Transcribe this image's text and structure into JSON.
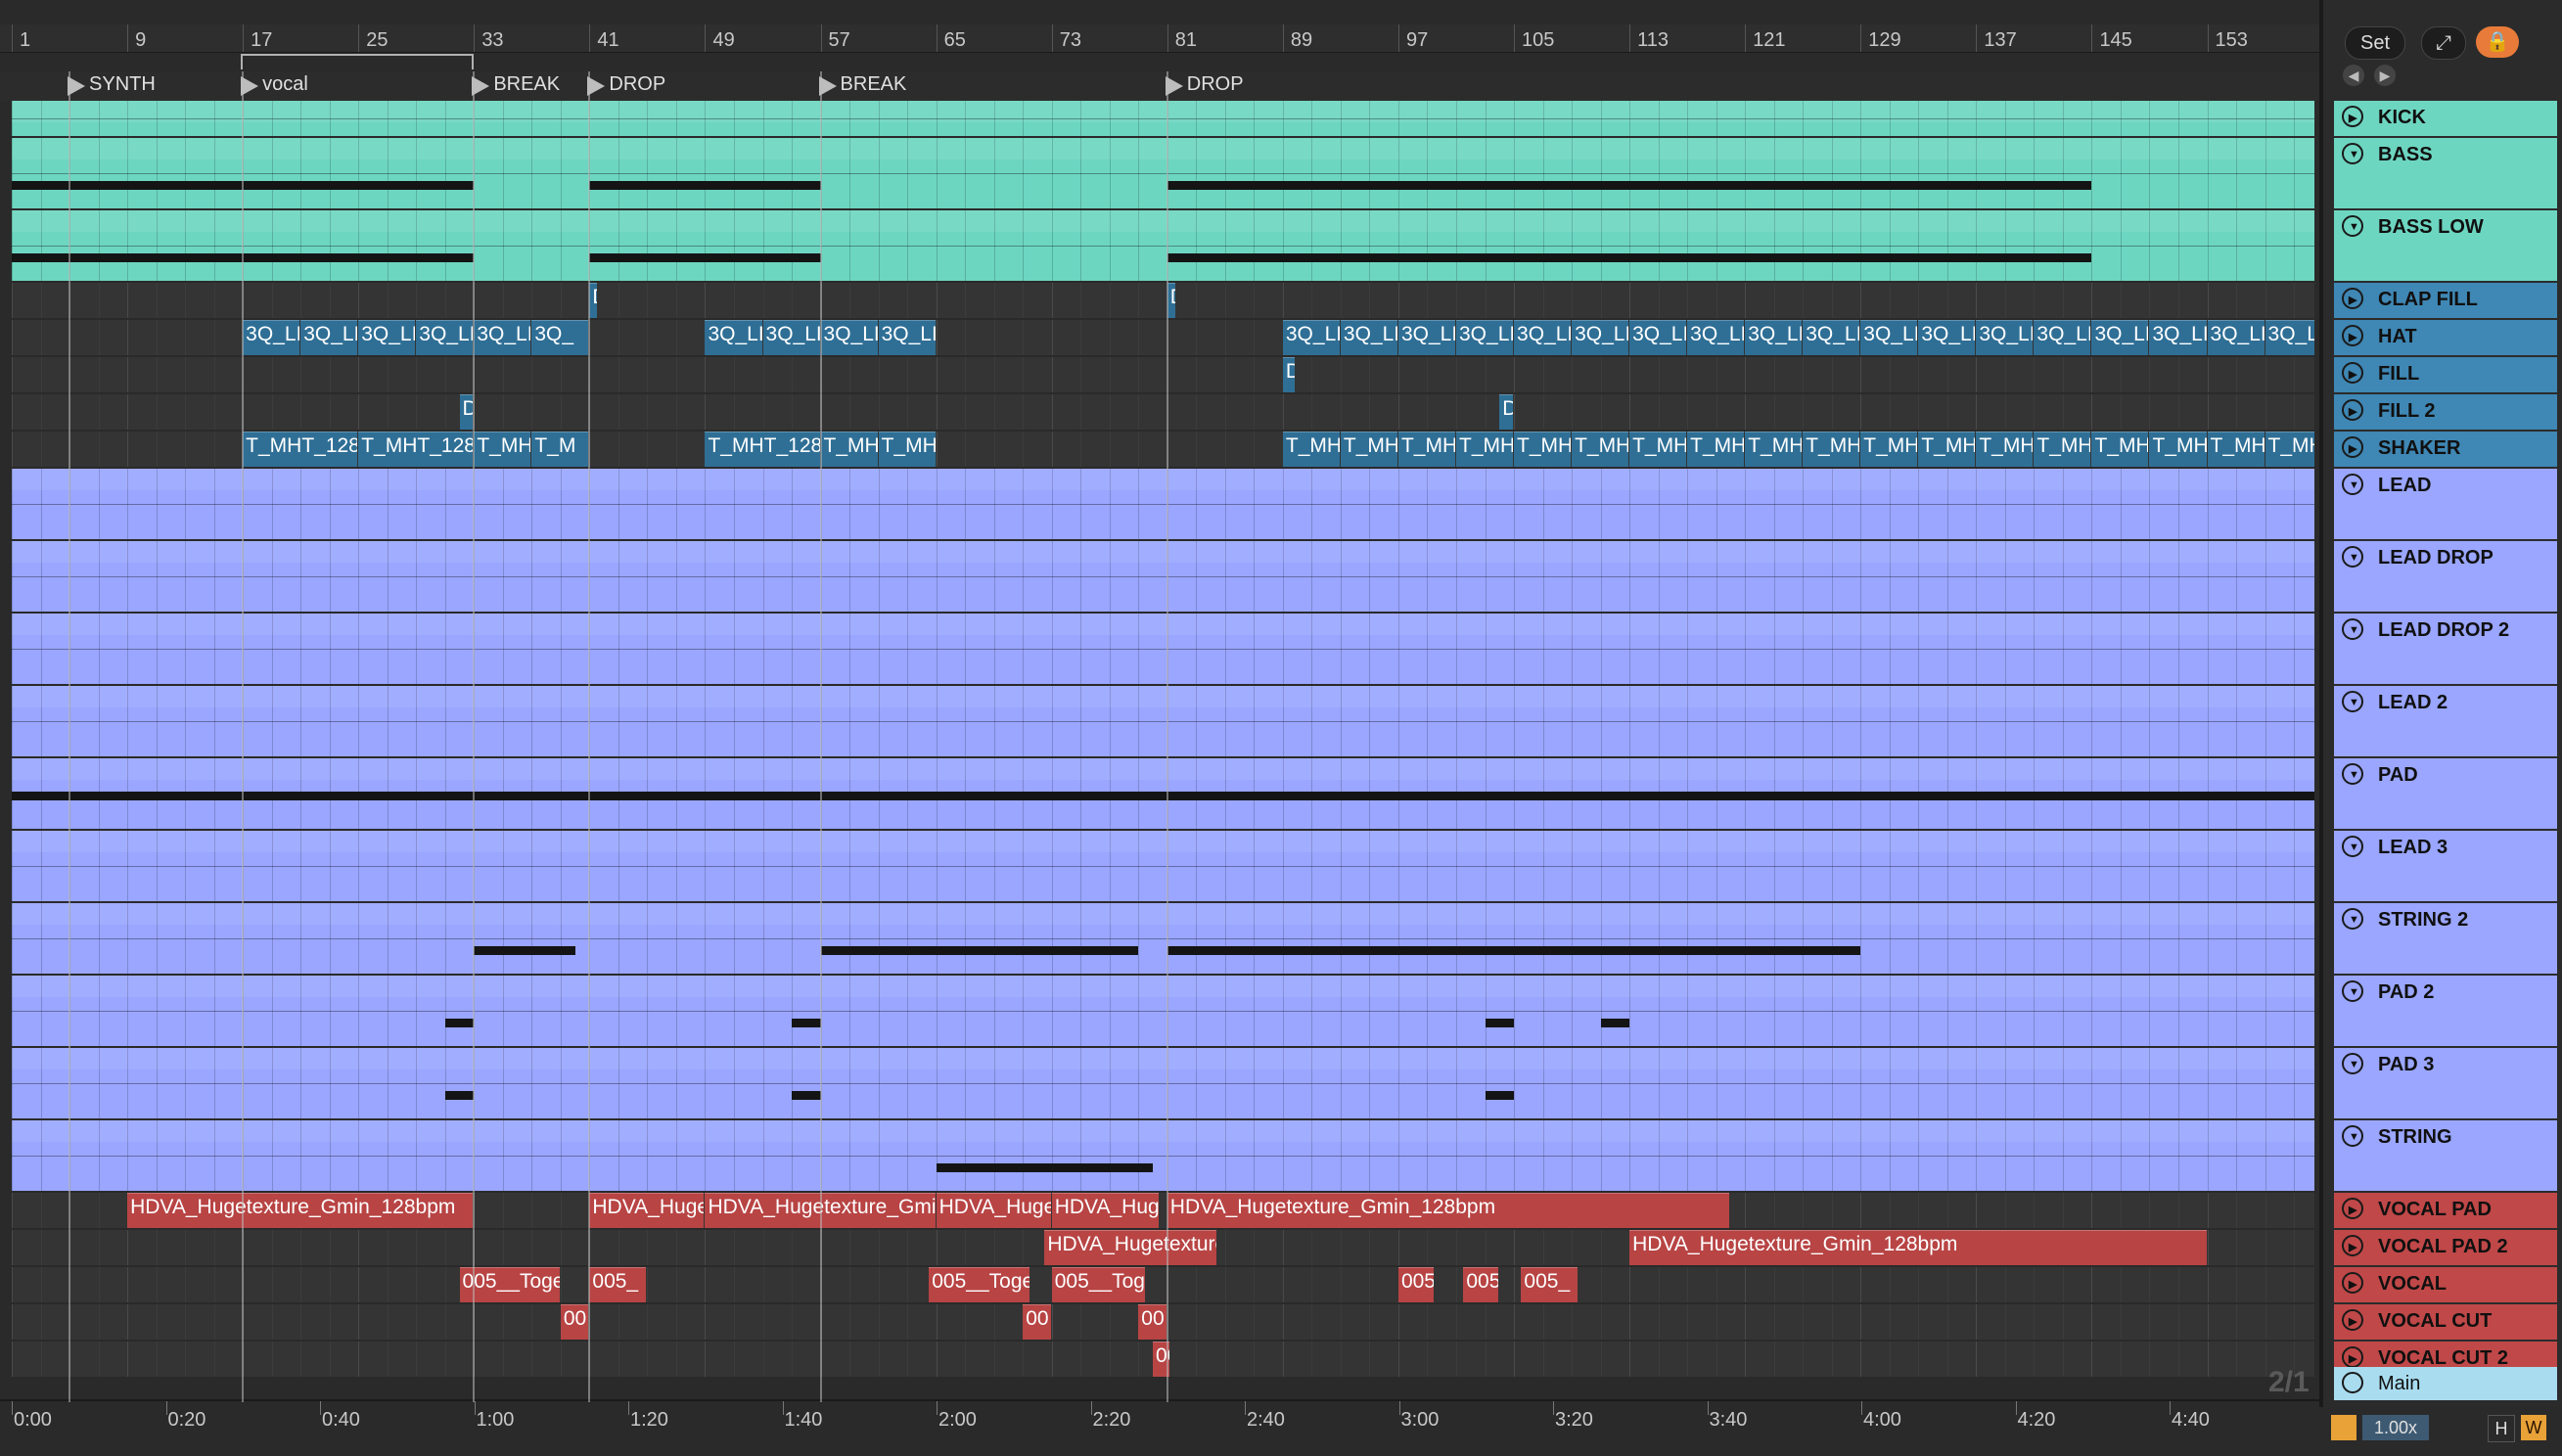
{
  "bar_numbers": [
    "1",
    "9",
    "17",
    "25",
    "33",
    "41",
    "49",
    "57",
    "65",
    "73",
    "81",
    "89",
    "97",
    "105",
    "113",
    "121",
    "129",
    "137",
    "145",
    "153"
  ],
  "locators": [
    {
      "label": "SYNTH",
      "bar": 5
    },
    {
      "label": "vocal",
      "bar": 17
    },
    {
      "label": "BREAK",
      "bar": 33
    },
    {
      "label": "DROP",
      "bar": 41
    },
    {
      "label": "BREAK",
      "bar": 57
    },
    {
      "label": "DROP",
      "bar": 81
    }
  ],
  "time_labels": [
    "0:00",
    "0:20",
    "0:40",
    "1:00",
    "1:20",
    "1:40",
    "2:00",
    "2:20",
    "2:40",
    "3:00",
    "3:20",
    "3:40",
    "4:00",
    "4:20",
    "4:40"
  ],
  "top_controls": {
    "set_label": "Set"
  },
  "tracks": [
    {
      "name": "KICK",
      "color": "#6dd6c1",
      "type": "audio",
      "height": "small"
    },
    {
      "name": "BASS",
      "color": "#6dd6c1",
      "type": "midi",
      "height": "large"
    },
    {
      "name": "BASS LOW",
      "color": "#6dd6c1",
      "type": "midi",
      "height": "large"
    },
    {
      "name": "CLAP FILL",
      "color": "#2f6f96",
      "type": "audio",
      "height": "small"
    },
    {
      "name": "HAT",
      "color": "#2f6f96",
      "type": "audio",
      "height": "small"
    },
    {
      "name": "FILL",
      "color": "#2f6f96",
      "type": "audio",
      "height": "small"
    },
    {
      "name": "FILL 2",
      "color": "#2f6f96",
      "type": "audio",
      "height": "small"
    },
    {
      "name": "SHAKER",
      "color": "#2f6f96",
      "type": "audio",
      "height": "small"
    },
    {
      "name": "LEAD",
      "color": "#9aa6ff",
      "type": "midi",
      "height": "large"
    },
    {
      "name": "LEAD DROP",
      "color": "#9aa6ff",
      "type": "midi",
      "height": "large"
    },
    {
      "name": "LEAD DROP 2",
      "color": "#9aa6ff",
      "type": "midi",
      "height": "large"
    },
    {
      "name": "LEAD 2",
      "color": "#9aa6ff",
      "type": "midi",
      "height": "large"
    },
    {
      "name": "PAD",
      "color": "#9aa6ff",
      "type": "midi",
      "height": "large"
    },
    {
      "name": "LEAD 3",
      "color": "#9aa6ff",
      "type": "midi",
      "height": "large"
    },
    {
      "name": "STRING 2",
      "color": "#9aa6ff",
      "type": "midi",
      "height": "large"
    },
    {
      "name": "PAD 2",
      "color": "#9aa6ff",
      "type": "midi",
      "height": "large"
    },
    {
      "name": "PAD 3",
      "color": "#9aa6ff",
      "type": "midi",
      "height": "large"
    },
    {
      "name": "STRING",
      "color": "#9aa6ff",
      "type": "midi",
      "height": "large"
    },
    {
      "name": "VOCAL PAD",
      "color": "#b84444",
      "type": "audio",
      "height": "small"
    },
    {
      "name": "VOCAL PAD 2",
      "color": "#b84444",
      "type": "audio",
      "height": "small"
    },
    {
      "name": "VOCAL",
      "color": "#b84444",
      "type": "audio",
      "height": "small"
    },
    {
      "name": "VOCAL CUT",
      "color": "#b84444",
      "type": "audio",
      "height": "small"
    },
    {
      "name": "VOCAL CUT 2",
      "color": "#b84444",
      "type": "audio",
      "height": "small"
    }
  ],
  "clips": {
    "HAT": [
      {
        "s": 17,
        "e": 21,
        "n": "3Q_LI"
      },
      {
        "s": 21,
        "e": 25,
        "n": "3Q_LI"
      },
      {
        "s": 25,
        "e": 29,
        "n": "3Q_LI"
      },
      {
        "s": 29,
        "e": 33,
        "n": "3Q_LI"
      },
      {
        "s": 33,
        "e": 37,
        "n": "3Q_LI"
      },
      {
        "s": 37,
        "e": 41,
        "n": "3Q_"
      },
      {
        "s": 49,
        "e": 53,
        "n": "3Q_LI"
      },
      {
        "s": 53,
        "e": 57,
        "n": "3Q_LI"
      },
      {
        "s": 57,
        "e": 61,
        "n": "3Q_LI"
      },
      {
        "s": 61,
        "e": 65,
        "n": "3Q_LI"
      },
      {
        "s": 89,
        "e": 93,
        "n": "3Q_LI"
      },
      {
        "s": 93,
        "e": 97,
        "n": "3Q_LI"
      },
      {
        "s": 97,
        "e": 101,
        "n": "3Q_LI"
      },
      {
        "s": 101,
        "e": 105,
        "n": "3Q_LI"
      },
      {
        "s": 105,
        "e": 109,
        "n": "3Q_LI"
      },
      {
        "s": 109,
        "e": 113,
        "n": "3Q_LI"
      },
      {
        "s": 113,
        "e": 117,
        "n": "3Q_LI"
      },
      {
        "s": 117,
        "e": 121,
        "n": "3Q_LI"
      },
      {
        "s": 121,
        "e": 125,
        "n": "3Q_LI"
      },
      {
        "s": 125,
        "e": 129,
        "n": "3Q_LI"
      },
      {
        "s": 129,
        "e": 133,
        "n": "3Q_LI"
      },
      {
        "s": 133,
        "e": 137,
        "n": "3Q_LI"
      },
      {
        "s": 137,
        "e": 141,
        "n": "3Q_LI"
      },
      {
        "s": 141,
        "e": 145,
        "n": "3Q_LI"
      },
      {
        "s": 145,
        "e": 149,
        "n": "3Q_LI"
      },
      {
        "s": 149,
        "e": 153,
        "n": "3Q_LI"
      },
      {
        "s": 153,
        "e": 157,
        "n": "3Q_LI"
      },
      {
        "s": 157,
        "e": 161,
        "n": "3Q_LI"
      }
    ],
    "SHAKER": [
      {
        "s": 17,
        "e": 25,
        "n": "T_MHT_128"
      },
      {
        "s": 25,
        "e": 33,
        "n": "T_MHT_128"
      },
      {
        "s": 33,
        "e": 37,
        "n": "T_MH"
      },
      {
        "s": 37,
        "e": 41,
        "n": "T_M"
      },
      {
        "s": 49,
        "e": 57,
        "n": "T_MHT_128"
      },
      {
        "s": 57,
        "e": 61,
        "n": "T_MH"
      },
      {
        "s": 61,
        "e": 65,
        "n": "T_MH"
      },
      {
        "s": 89,
        "e": 93,
        "n": "T_MH"
      },
      {
        "s": 93,
        "e": 97,
        "n": "T_MH"
      },
      {
        "s": 97,
        "e": 101,
        "n": "T_MH"
      },
      {
        "s": 101,
        "e": 105,
        "n": "T_MH"
      },
      {
        "s": 105,
        "e": 109,
        "n": "T_MH"
      },
      {
        "s": 109,
        "e": 113,
        "n": "T_MH"
      },
      {
        "s": 113,
        "e": 117,
        "n": "T_MH"
      },
      {
        "s": 117,
        "e": 121,
        "n": "T_MH"
      },
      {
        "s": 121,
        "e": 125,
        "n": "T_MH"
      },
      {
        "s": 125,
        "e": 129,
        "n": "T_MH"
      },
      {
        "s": 129,
        "e": 133,
        "n": "T_MH"
      },
      {
        "s": 133,
        "e": 137,
        "n": "T_MH"
      },
      {
        "s": 137,
        "e": 141,
        "n": "T_MH"
      },
      {
        "s": 141,
        "e": 145,
        "n": "T_MH"
      },
      {
        "s": 145,
        "e": 149,
        "n": "T_MH"
      },
      {
        "s": 149,
        "e": 153,
        "n": "T_MH"
      },
      {
        "s": 153,
        "e": 157,
        "n": "T_MH"
      },
      {
        "s": 157,
        "e": 161,
        "n": "T_MH"
      }
    ],
    "CLAP FILL": [
      {
        "s": 41,
        "e": 41.6,
        "n": "D"
      },
      {
        "s": 81,
        "e": 81.6,
        "n": "D"
      }
    ],
    "FILL": [
      {
        "s": 89,
        "e": 89.9,
        "n": "D"
      }
    ],
    "FILL 2": [
      {
        "s": 32,
        "e": 33,
        "n": "D"
      },
      {
        "s": 104,
        "e": 105,
        "n": "D"
      }
    ],
    "VOCAL PAD": [
      {
        "s": 9,
        "e": 33,
        "n": "HDVA_Hugetexture_Gmin_128bpm"
      },
      {
        "s": 41,
        "e": 49,
        "n": "HDVA_Huge"
      },
      {
        "s": 49,
        "e": 65,
        "n": "HDVA_Hugetexture_Gmin_128bpm"
      },
      {
        "s": 65,
        "e": 73,
        "n": "HDVA_Huge"
      },
      {
        "s": 73,
        "e": 80.5,
        "n": "HDVA_Huge"
      },
      {
        "s": 81,
        "e": 120,
        "n": "HDVA_Hugetexture_Gmin_128bpm"
      }
    ],
    "VOCAL PAD 2": [
      {
        "s": 72.5,
        "e": 84.5,
        "n": "HDVA_Hugetexture"
      },
      {
        "s": 113,
        "e": 153,
        "n": "HDVA_Hugetexture_Gmin_128bpm"
      }
    ],
    "VOCAL": [
      {
        "s": 32,
        "e": 39,
        "n": "005__Together"
      },
      {
        "s": 41,
        "e": 45,
        "n": "005_"
      },
      {
        "s": 64.5,
        "e": 71.5,
        "n": "005__Together"
      },
      {
        "s": 73,
        "e": 79.5,
        "n": "005__Together"
      },
      {
        "s": 97,
        "e": 99.5,
        "n": "005"
      },
      {
        "s": 101.5,
        "e": 104,
        "n": "005"
      },
      {
        "s": 105.5,
        "e": 109.5,
        "n": "005_"
      }
    ],
    "VOCAL CUT": [
      {
        "s": 39,
        "e": 41,
        "n": "00"
      },
      {
        "s": 71,
        "e": 73,
        "n": "00"
      },
      {
        "s": 79,
        "e": 81,
        "n": "00"
      }
    ],
    "VOCAL CUT 2": [
      {
        "s": 80,
        "e": 81.2,
        "n": "00"
      }
    ]
  },
  "midi": {
    "BASS": [
      {
        "s": 1,
        "e": 33
      },
      {
        "s": 41,
        "e": 57
      },
      {
        "s": 81,
        "e": 145
      }
    ],
    "BASS LOW": [
      {
        "s": 1,
        "e": 33
      },
      {
        "s": 41,
        "e": 57
      },
      {
        "s": 81,
        "e": 145
      }
    ],
    "STRING 2": [
      {
        "s": 33,
        "e": 40
      },
      {
        "s": 57,
        "e": 79
      },
      {
        "s": 81,
        "e": 129
      }
    ],
    "PAD 2": [
      {
        "s": 31,
        "e": 33
      },
      {
        "s": 55,
        "e": 57
      },
      {
        "s": 103,
        "e": 105
      },
      {
        "s": 111,
        "e": 113
      }
    ],
    "PAD 3": [
      {
        "s": 31,
        "e": 33
      },
      {
        "s": 55,
        "e": 57
      },
      {
        "s": 103,
        "e": 105
      }
    ],
    "STRING": [
      {
        "s": 65,
        "e": 80
      }
    ],
    "PAD": [
      {
        "s": 1,
        "e": 161
      }
    ]
  },
  "bottom_right_label": "2/1",
  "main_track": "Main",
  "zoom_label": "1.00x",
  "flags": {
    "h": "H",
    "w": "W"
  }
}
